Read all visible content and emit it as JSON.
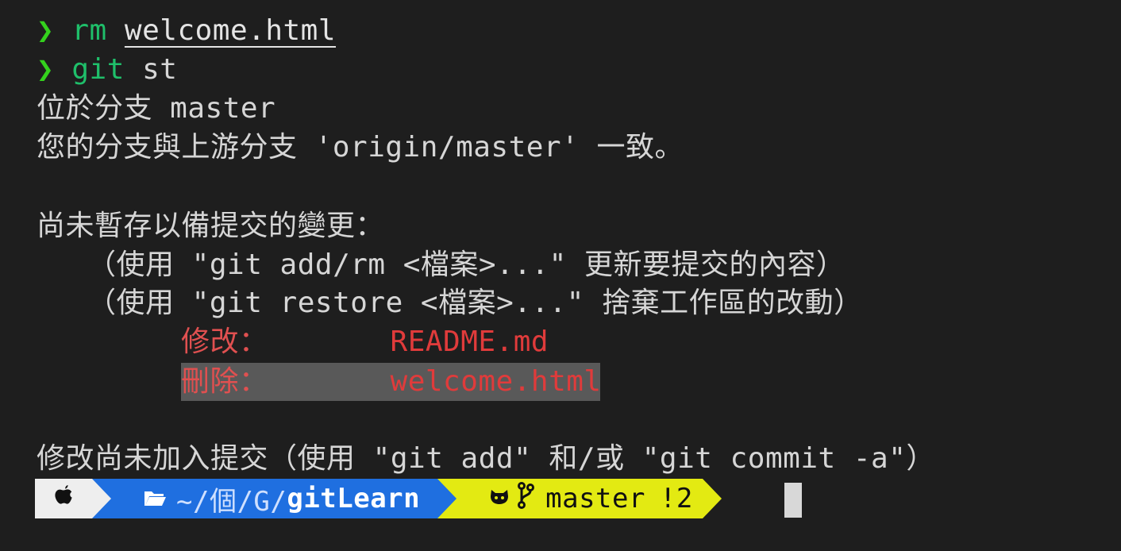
{
  "terminal": {
    "lines": {
      "l1_arrow": "❯",
      "l1_cmd": "rm",
      "l1_arg": "welcome.html",
      "l2_arrow": "❯",
      "l2_cmd": "git",
      "l2_arg": "st",
      "l3": "位於分支 master",
      "l4": "您的分支與上游分支 'origin/master' 一致。",
      "l6": "尚未暫存以備提交的變更：",
      "l7": "（使用 \"git add/rm <檔案>...\" 更新要提交的內容）",
      "l8": "（使用 \"git restore <檔案>...\" 捨棄工作區的改動）",
      "l9_status": "修改：",
      "l9_file": "README.md",
      "l10_status": "刪除：",
      "l10_file": "welcome.html",
      "l12": "修改尚未加入提交（使用 \"git add\" 和/或 \"git commit -a\"）"
    },
    "prompt": {
      "path_prefix": "~/個/G/",
      "path_dir": "gitLearn",
      "branch": "master",
      "status": "!2"
    },
    "colors": {
      "background": "#1e1e1e",
      "prompt_arrow": "#34d11d",
      "command": "#1fbf6a",
      "changed_file": "#e03b3b",
      "path_segment": "#1f6fe0",
      "git_segment": "#e3ea12",
      "apple_segment": "#eeeeee"
    },
    "icons": [
      "apple-icon",
      "folder-icon",
      "github-cat-icon",
      "git-branch-icon"
    ]
  }
}
